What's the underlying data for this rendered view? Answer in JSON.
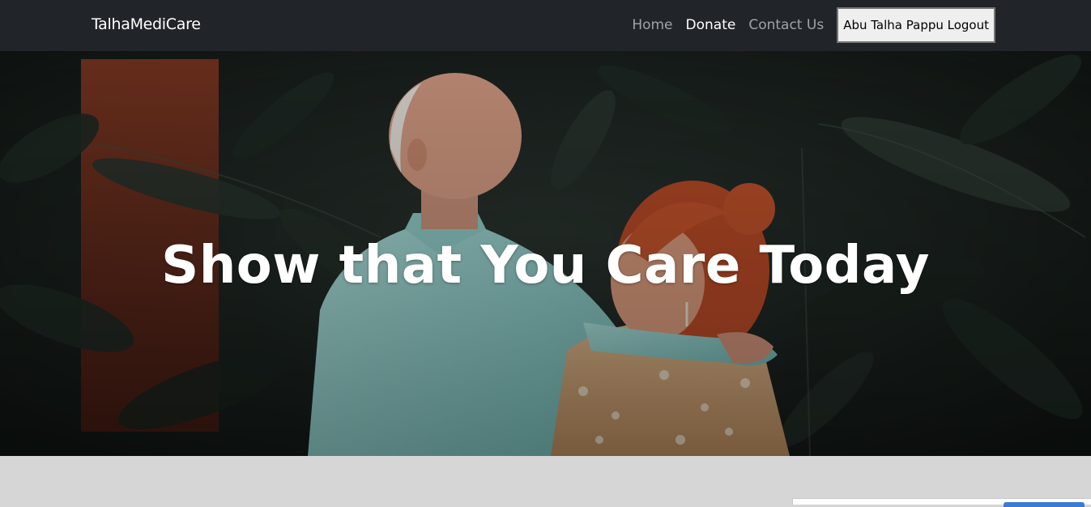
{
  "nav": {
    "brand": "TalhaMediCare",
    "links": [
      {
        "label": "Home",
        "active": false
      },
      {
        "label": "Donate",
        "active": true
      },
      {
        "label": "Contact Us",
        "active": false
      }
    ],
    "user_button_label": "Abu Talha Pappu Logout"
  },
  "hero": {
    "title": "Show that You Care Today",
    "image": "elderly-couple-smiling-photo"
  },
  "colors": {
    "navbar_bg": "#212529",
    "nav_active": "#ffffff",
    "nav_inactive": "#a0a3a6",
    "page_bg": "#d6d6d6"
  }
}
